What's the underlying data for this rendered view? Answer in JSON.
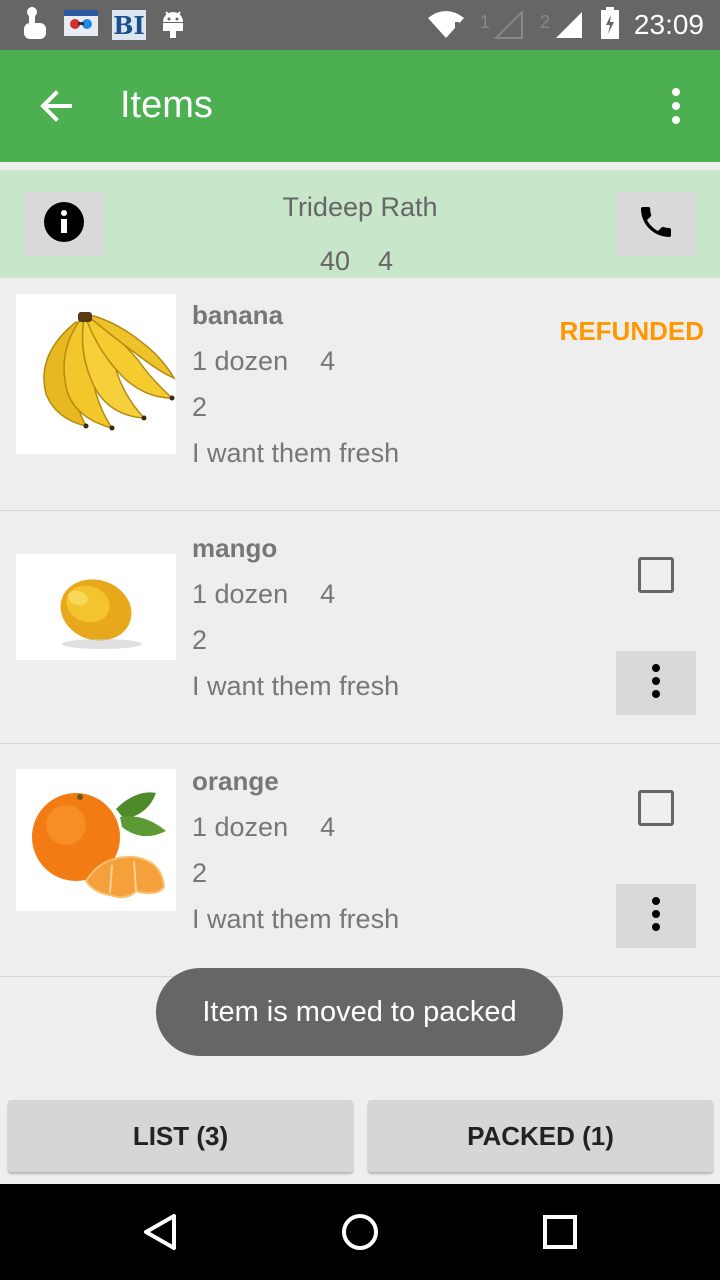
{
  "status_bar": {
    "time": "23:09",
    "bi_label": "BI",
    "sim1": "1",
    "sim2": "2"
  },
  "app_bar": {
    "title": "Items",
    "color": "#4caf50"
  },
  "customer": {
    "name": "Trideep Rath",
    "num1": "40",
    "num2": "4"
  },
  "items": [
    {
      "name": "banana",
      "quantity": "1 dozen",
      "count": "4",
      "line2": "2",
      "note": "I want them fresh",
      "status": "REFUNDED"
    },
    {
      "name": "mango",
      "quantity": "1 dozen",
      "count": "4",
      "line2": "2",
      "note": "I want them fresh"
    },
    {
      "name": "orange",
      "quantity": "1 dozen",
      "count": "4",
      "line2": "2",
      "note": "I want them fresh"
    }
  ],
  "toast": "Item is moved to packed",
  "tabs": {
    "list": "LIST (3)",
    "packed": "PACKED (1)"
  },
  "colors": {
    "accent": "#4caf50",
    "customer_bg": "#c8e6c9",
    "refunded": "#ff9800"
  }
}
